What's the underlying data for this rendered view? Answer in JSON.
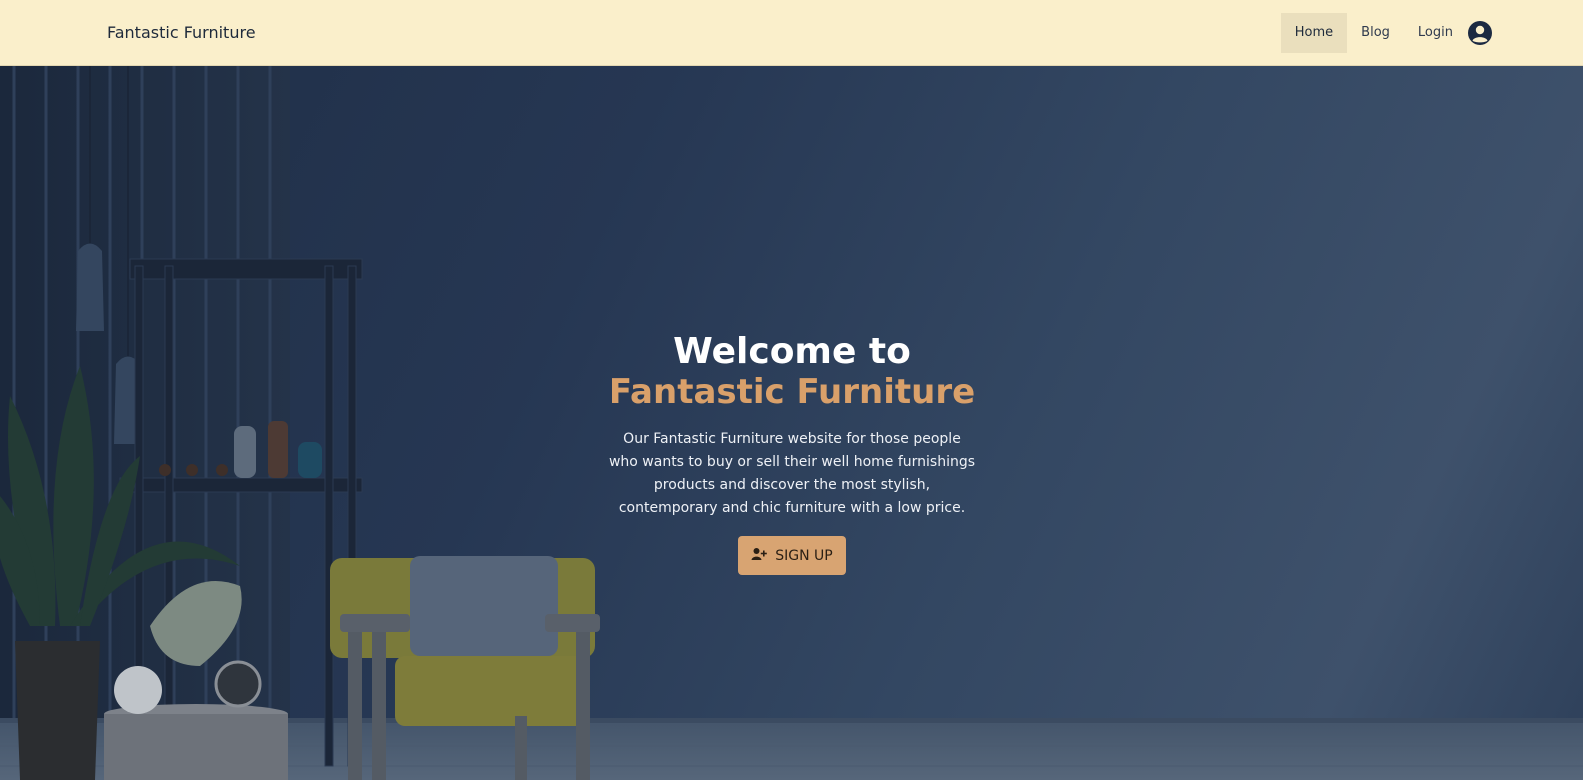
{
  "navbar": {
    "brand": "Fantastic Furniture",
    "links": [
      {
        "label": "Home",
        "active": true
      },
      {
        "label": "Blog",
        "active": false
      },
      {
        "label": "Login",
        "active": false
      }
    ],
    "avatar_icon": "user-circle-icon"
  },
  "hero": {
    "title_line1": "Welcome to",
    "title_line2": "Fantastic Furniture",
    "description": "Our Fantastic Furniture website for those people who wants to buy or sell their well home furnishings products and discover the most stylish, contemporary and chic furniture with a low price.",
    "cta_label": "SIGN UP",
    "cta_icon": "user-plus-icon",
    "background_image": "dark blue living room with armchair, shelf and plants"
  },
  "colors": {
    "navbar_bg": "#faefcb",
    "accent": "#d9a06a",
    "button_bg": "#d8a472",
    "hero_bg": "#2b3b55"
  }
}
